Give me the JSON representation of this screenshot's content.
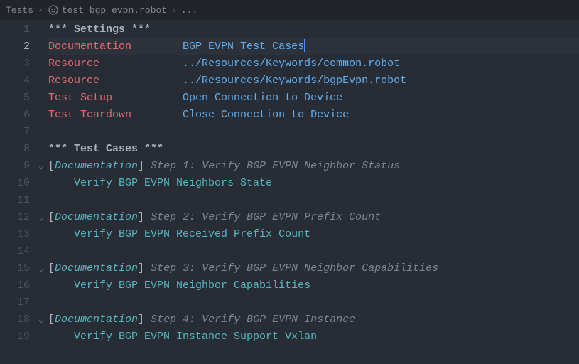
{
  "breadcrumb": {
    "root": "Tests",
    "file": "test_bgp_evpn.robot",
    "tail": "..."
  },
  "active_line": 2,
  "lines": [
    {
      "n": 1,
      "fold": "",
      "segs": [
        {
          "t": "*** Settings ***",
          "c": "section"
        }
      ]
    },
    {
      "n": 2,
      "fold": "",
      "cursor": true,
      "diff": true,
      "segs": [
        {
          "t": "Documentation",
          "c": "setting-name"
        },
        {
          "t": "        ",
          "c": "text"
        },
        {
          "t": "BGP EVPN Test Cases",
          "c": "setting-val"
        }
      ]
    },
    {
      "n": 3,
      "fold": "",
      "segs": [
        {
          "t": "Resource",
          "c": "setting-name"
        },
        {
          "t": "             ",
          "c": "text"
        },
        {
          "t": "../Resources/Keywords/common.robot",
          "c": "setting-val"
        }
      ]
    },
    {
      "n": 4,
      "fold": "",
      "segs": [
        {
          "t": "Resource",
          "c": "setting-name"
        },
        {
          "t": "             ",
          "c": "text"
        },
        {
          "t": "../Resources/Keywords/bgpEvpn.robot",
          "c": "setting-val"
        }
      ]
    },
    {
      "n": 5,
      "fold": "",
      "segs": [
        {
          "t": "Test Setup",
          "c": "setting-name"
        },
        {
          "t": "           ",
          "c": "text"
        },
        {
          "t": "Open Connection to Device",
          "c": "setting-val"
        }
      ]
    },
    {
      "n": 6,
      "fold": "",
      "segs": [
        {
          "t": "Test Teardown",
          "c": "setting-name"
        },
        {
          "t": "        ",
          "c": "text"
        },
        {
          "t": "Close Connection to Device",
          "c": "setting-val"
        }
      ]
    },
    {
      "n": 7,
      "fold": "",
      "segs": []
    },
    {
      "n": 8,
      "fold": "",
      "segs": [
        {
          "t": "*** Test Cases ***",
          "c": "section"
        }
      ]
    },
    {
      "n": 9,
      "fold": "⌄",
      "segs": [
        {
          "t": "[",
          "c": "bracket"
        },
        {
          "t": "Documentation",
          "c": "doc-tag"
        },
        {
          "t": "]",
          "c": "bracket"
        },
        {
          "t": " ",
          "c": "text"
        },
        {
          "t": "Step 1: Verify BGP EVPN Neighbor Status",
          "c": "comment"
        }
      ]
    },
    {
      "n": 10,
      "fold": "",
      "segs": [
        {
          "t": "    ",
          "c": "text"
        },
        {
          "t": "Verify BGP EVPN Neighbors State",
          "c": "keyword-call"
        }
      ]
    },
    {
      "n": 11,
      "fold": "",
      "segs": []
    },
    {
      "n": 12,
      "fold": "⌄",
      "segs": [
        {
          "t": "[",
          "c": "bracket"
        },
        {
          "t": "Documentation",
          "c": "doc-tag"
        },
        {
          "t": "]",
          "c": "bracket"
        },
        {
          "t": " ",
          "c": "text"
        },
        {
          "t": "Step 2: Verify BGP EVPN Prefix Count",
          "c": "comment"
        }
      ]
    },
    {
      "n": 13,
      "fold": "",
      "segs": [
        {
          "t": "    ",
          "c": "text"
        },
        {
          "t": "Verify BGP EVPN Received Prefix Count",
          "c": "keyword-call"
        }
      ]
    },
    {
      "n": 14,
      "fold": "",
      "segs": []
    },
    {
      "n": 15,
      "fold": "⌄",
      "segs": [
        {
          "t": "[",
          "c": "bracket"
        },
        {
          "t": "Documentation",
          "c": "doc-tag"
        },
        {
          "t": "]",
          "c": "bracket"
        },
        {
          "t": " ",
          "c": "text"
        },
        {
          "t": "Step 3: Verify BGP EVPN Neighbor Capabilities",
          "c": "comment"
        }
      ]
    },
    {
      "n": 16,
      "fold": "",
      "segs": [
        {
          "t": "    ",
          "c": "text"
        },
        {
          "t": "Verify BGP EVPN Neighbor Capabilities",
          "c": "keyword-call"
        }
      ]
    },
    {
      "n": 17,
      "fold": "",
      "segs": []
    },
    {
      "n": 18,
      "fold": "⌄",
      "segs": [
        {
          "t": "[",
          "c": "bracket"
        },
        {
          "t": "Documentation",
          "c": "doc-tag"
        },
        {
          "t": "]",
          "c": "bracket"
        },
        {
          "t": " ",
          "c": "text"
        },
        {
          "t": "Step 4: Verify BGP EVPN Instance",
          "c": "comment"
        }
      ]
    },
    {
      "n": 19,
      "fold": "",
      "segs": [
        {
          "t": "    ",
          "c": "text"
        },
        {
          "t": "Verify BGP EVPN Instance Support Vxlan",
          "c": "keyword-call"
        }
      ]
    }
  ]
}
